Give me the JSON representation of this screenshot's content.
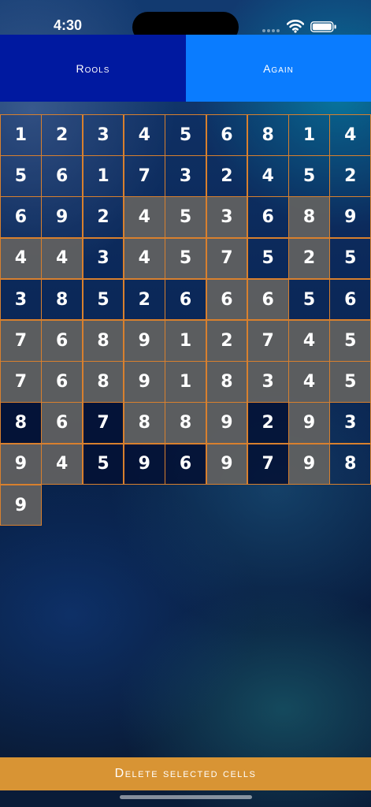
{
  "status_bar": {
    "time": "4:30",
    "icons": [
      "signal-icon",
      "wifi-icon",
      "battery-icon"
    ]
  },
  "toolbar": {
    "rools_label": "Rools",
    "again_label": "Again"
  },
  "grid": {
    "columns": 9,
    "rows": [
      [
        "1",
        "2",
        "3",
        "4",
        "5",
        "6",
        "8",
        "1",
        "4"
      ],
      [
        "5",
        "6",
        "1",
        "7",
        "3",
        "2",
        "4",
        "5",
        "2"
      ],
      [
        "6",
        "9",
        "2",
        "4",
        "5",
        "3",
        "6",
        "8",
        "9"
      ],
      [
        "4",
        "4",
        "3",
        "4",
        "5",
        "7",
        "5",
        "2",
        "5"
      ],
      [
        "3",
        "8",
        "5",
        "2",
        "6",
        "6",
        "6",
        "5",
        "6"
      ],
      [
        "7",
        "6",
        "8",
        "9",
        "1",
        "2",
        "7",
        "4",
        "5"
      ],
      [
        "7",
        "6",
        "8",
        "9",
        "1",
        "8",
        "3",
        "4",
        "5"
      ],
      [
        "8",
        "6",
        "7",
        "8",
        "8",
        "9",
        "2",
        "9",
        "3"
      ],
      [
        "9",
        "4",
        "5",
        "9",
        "6",
        "9",
        "7",
        "9",
        "8"
      ],
      [
        "9"
      ]
    ],
    "cell_styles": [
      [
        "clear",
        "clear",
        "clear",
        "clear",
        "clear",
        "clear",
        "clear",
        "clear",
        "clear"
      ],
      [
        "clear",
        "clear",
        "clear",
        "clear",
        "clear",
        "clear",
        "clear",
        "clear",
        "clear"
      ],
      [
        "clear",
        "clear",
        "clear",
        "grey",
        "grey",
        "grey",
        "clear",
        "grey",
        "clear"
      ],
      [
        "grey",
        "grey",
        "clear",
        "grey",
        "grey",
        "grey",
        "clear",
        "grey",
        "clear"
      ],
      [
        "clear",
        "clear",
        "clear",
        "clear",
        "clear",
        "grey",
        "grey",
        "clear",
        "clear"
      ],
      [
        "grey",
        "grey",
        "grey",
        "grey",
        "grey",
        "grey",
        "grey",
        "grey",
        "grey"
      ],
      [
        "grey",
        "grey",
        "grey",
        "grey",
        "grey",
        "grey",
        "grey",
        "grey",
        "grey"
      ],
      [
        "dark",
        "grey",
        "dark",
        "grey",
        "grey",
        "grey",
        "dark",
        "grey",
        "clear"
      ],
      [
        "grey",
        "grey",
        "dark",
        "dark",
        "dark",
        "grey",
        "dark",
        "grey",
        "clear"
      ],
      [
        "grey"
      ]
    ],
    "border_color": "#d8802e"
  },
  "actions": {
    "delete_label": "Delete selected cells"
  },
  "colors": {
    "rools_bg": "#0019a0",
    "again_bg": "#0a7cff",
    "delete_bg": "#d89434",
    "grey_cell": "#606060"
  }
}
